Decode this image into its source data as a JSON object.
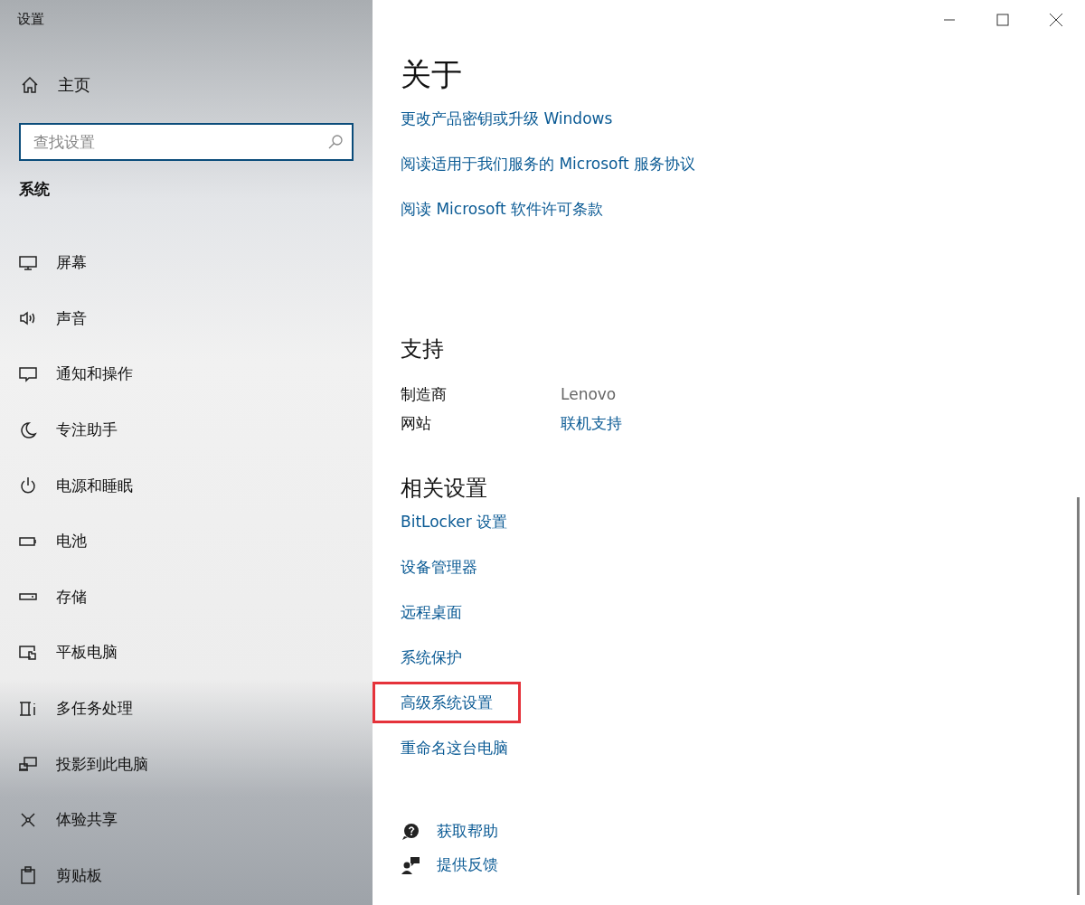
{
  "window": {
    "title": "设置"
  },
  "sidebar": {
    "home": "主页",
    "search": {
      "placeholder": "查找设置"
    },
    "section": "系统",
    "items": [
      {
        "label": "屏幕",
        "selected": false
      },
      {
        "label": "声音",
        "selected": false
      },
      {
        "label": "通知和操作",
        "selected": false
      },
      {
        "label": "专注助手",
        "selected": false
      },
      {
        "label": "电源和睡眠",
        "selected": false
      },
      {
        "label": "电池",
        "selected": false
      },
      {
        "label": "存储",
        "selected": false
      },
      {
        "label": "平板电脑",
        "selected": false
      },
      {
        "label": "多任务处理",
        "selected": false
      },
      {
        "label": "投影到此电脑",
        "selected": false
      },
      {
        "label": "体验共享",
        "selected": false
      },
      {
        "label": "剪贴板",
        "selected": false
      }
    ]
  },
  "about": {
    "heading": "关于",
    "links": [
      {
        "label": "更改产品密钥或升级 Windows"
      },
      {
        "label": "阅读适用于我们服务的 Microsoft 服务协议"
      },
      {
        "label": "阅读 Microsoft 软件许可条款"
      }
    ]
  },
  "support": {
    "heading": "支持",
    "rows": [
      {
        "label": "制造商",
        "value": "Lenovo",
        "kind": "text"
      },
      {
        "label": "网站",
        "value": "联机支持",
        "kind": "link"
      }
    ]
  },
  "related": {
    "heading": "相关设置",
    "links": [
      {
        "label": "BitLocker 设置",
        "highlighted": false
      },
      {
        "label": "设备管理器",
        "highlighted": false
      },
      {
        "label": "远程桌面",
        "highlighted": false
      },
      {
        "label": "系统保护",
        "highlighted": false
      },
      {
        "label": "高级系统设置",
        "highlighted": true
      },
      {
        "label": "重命名这台电脑",
        "highlighted": false
      }
    ]
  },
  "help": [
    {
      "label": "获取帮助"
    },
    {
      "label": "提供反馈"
    }
  ]
}
